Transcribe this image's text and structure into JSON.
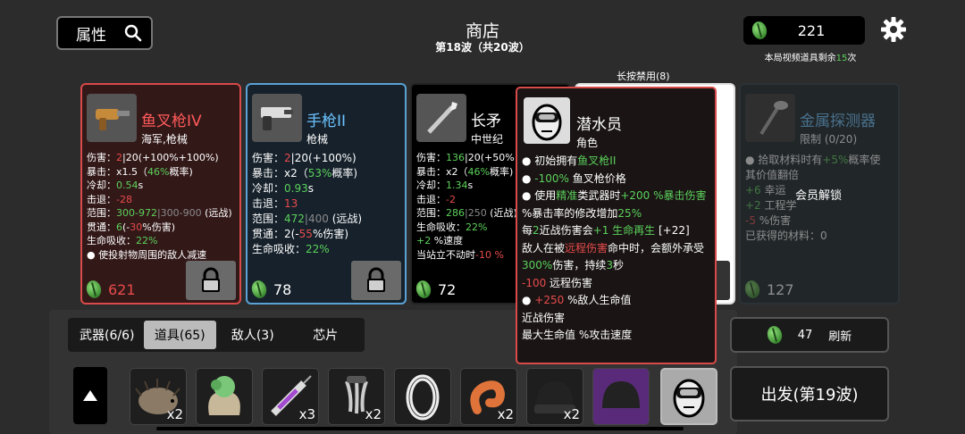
{
  "header": {
    "attr_button": "属性",
    "shop_title": "商店",
    "wave_text": "第18波（共20波）",
    "currency_value": "221",
    "video_prefix": "本局视频道具剩余",
    "video_count": "15",
    "video_suffix": "次",
    "long_press": "长按禁用(8)"
  },
  "cards": [
    {
      "name": "鱼叉枪IV",
      "type": "海军,枪械",
      "price": "621",
      "stats": [
        [
          [
            "伤害：",
            ""
          ],
          [
            "2",
            "red"
          ],
          [
            "|20(+100%",
            ""
          ],
          [
            "+100%)",
            ""
          ]
        ],
        [
          [
            "暴击：x1.5（",
            ""
          ],
          [
            "46%",
            "green"
          ],
          [
            "概率)",
            ""
          ]
        ],
        [
          [
            "冷却：",
            ""
          ],
          [
            "0.54",
            "green"
          ],
          [
            "s",
            ""
          ]
        ],
        [
          [
            "击退：",
            ""
          ],
          [
            "-28",
            "red"
          ]
        ],
        [
          [
            "范围：",
            ""
          ],
          [
            "300-972",
            "green"
          ],
          [
            "|300-900",
            "grey"
          ],
          [
            " (远战)",
            ""
          ]
        ],
        [
          [
            "贯通：",
            ""
          ],
          [
            "6",
            "green"
          ],
          [
            "(-",
            ""
          ],
          [
            "30",
            "red"
          ],
          [
            "%伤害)",
            ""
          ]
        ],
        [
          [
            "生命吸收：",
            ""
          ],
          [
            "22%",
            "green"
          ]
        ],
        [
          [
            "● 使投射物周围的敌人减速",
            ""
          ]
        ]
      ]
    },
    {
      "name": "手枪II",
      "type": "枪械",
      "price": "78",
      "stats": [
        [
          [
            "伤害：",
            ""
          ],
          [
            "2",
            "red"
          ],
          [
            "|20(+100%",
            ""
          ],
          [
            ")",
            ""
          ]
        ],
        [
          [
            "暴击：x2（",
            ""
          ],
          [
            "53%",
            "green"
          ],
          [
            "概率)",
            ""
          ]
        ],
        [
          [
            "冷却：",
            ""
          ],
          [
            "0.93",
            "green"
          ],
          [
            "s",
            ""
          ]
        ],
        [
          [
            "击退：",
            ""
          ],
          [
            "13",
            "red"
          ]
        ],
        [
          [
            "范围：",
            ""
          ],
          [
            "472",
            "green"
          ],
          [
            "|400",
            "grey"
          ],
          [
            " (远战)",
            ""
          ]
        ],
        [
          [
            "贯通：2(-",
            ""
          ],
          [
            "55",
            "red"
          ],
          [
            "%伤害)",
            ""
          ]
        ],
        [
          [
            "生命吸收：",
            ""
          ],
          [
            "22%",
            "green"
          ]
        ]
      ]
    },
    {
      "name": "长矛",
      "type": "中世纪",
      "price": "72",
      "stats": [
        [
          [
            "伤害：",
            ""
          ],
          [
            "136",
            "green"
          ],
          [
            "|20(+50%",
            ""
          ]
        ],
        [
          [
            "暴击：x2（",
            ""
          ],
          [
            "46%",
            "green"
          ],
          [
            "概率)",
            ""
          ]
        ],
        [
          [
            "冷却：",
            ""
          ],
          [
            "1.34",
            "green"
          ],
          [
            "s",
            ""
          ]
        ],
        [
          [
            "击退：",
            ""
          ],
          [
            "-2",
            "red"
          ]
        ],
        [
          [
            "范围：",
            ""
          ],
          [
            "286",
            "green"
          ],
          [
            "|250",
            "grey"
          ],
          [
            " (近战)",
            ""
          ]
        ],
        [
          [
            "生命吸收：",
            ""
          ],
          [
            "22%",
            "green"
          ]
        ],
        [
          [
            "+2",
            "green"
          ],
          [
            " %速度",
            ""
          ]
        ],
        [
          [
            "当站立不动时",
            ""
          ],
          [
            "-10 %",
            "red"
          ]
        ]
      ]
    },
    {
      "name": "",
      "type": "",
      "price": ""
    },
    {
      "name": "金属探测器",
      "type": "限制 (0/20)",
      "price": "127",
      "stats": [
        [
          [
            "● 拾取材料时有",
            ""
          ],
          [
            "+5%",
            "green"
          ],
          [
            "概率使",
            ""
          ]
        ],
        [
          [
            "其价值翻倍",
            ""
          ]
        ],
        [
          [
            "+6",
            "green"
          ],
          [
            " 幸运",
            ""
          ]
        ],
        [
          [
            "+2",
            "green"
          ],
          [
            " 工程学",
            ""
          ]
        ],
        [
          [
            "-5",
            "red"
          ],
          [
            " %伤害",
            ""
          ]
        ],
        [
          [
            "已获得的材料：0",
            ""
          ]
        ]
      ]
    }
  ],
  "member_unlock": "会员解锁",
  "tooltip": {
    "name": "潜水员",
    "type": "角色",
    "lines": [
      [
        [
          "● 初始拥有",
          ""
        ],
        [
          "鱼叉枪II",
          "green"
        ]
      ],
      [
        [
          "● ",
          ""
        ],
        [
          "-100%",
          "green"
        ],
        [
          " 鱼叉枪",
          ""
        ],
        [
          "价格",
          ""
        ]
      ],
      [
        [
          "● 使用",
          ""
        ],
        [
          "精准",
          "green"
        ],
        [
          "类武器时",
          ""
        ],
        [
          "+200 %暴击伤害",
          "green"
        ]
      ],
      [
        [
          "%暴击率",
          ""
        ],
        [
          "的修改增加",
          ""
        ],
        [
          "25%",
          "green"
        ]
      ],
      [
        [
          "每",
          ""
        ],
        [
          "2",
          "green"
        ],
        [
          "近战伤害会",
          ""
        ],
        [
          "+1 生命再生",
          "green"
        ],
        [
          " [+22]",
          ""
        ]
      ],
      [
        [
          "敌人在被",
          ""
        ],
        [
          "远程伤害",
          "red"
        ],
        [
          "命中时，会额外承受",
          ""
        ],
        [
          "300%",
          "green"
        ],
        [
          "伤害，持续",
          ""
        ],
        [
          "3",
          "green"
        ],
        [
          "秒",
          ""
        ]
      ],
      [
        [
          "-100",
          "red"
        ],
        [
          " 远程伤害",
          ""
        ]
      ],
      [
        [
          "● ",
          ""
        ],
        [
          "+250",
          "red"
        ],
        [
          " %敌人生命值",
          ""
        ]
      ],
      [
        [
          "近战伤害",
          ""
        ]
      ],
      [
        [
          "最大生命值    ",
          ""
        ],
        [
          "%攻击速度",
          ""
        ]
      ]
    ]
  },
  "tabs": [
    "武器(6/6)",
    "道具(65)",
    "敌人(3)",
    "芯片"
  ],
  "active_tab": 1,
  "refresh": {
    "cost": "47",
    "label": "刷新"
  },
  "depart": "出发(第19波)",
  "items": [
    {
      "name": "hedgehog",
      "count": "x2"
    },
    {
      "name": "moss-sack",
      "count": ""
    },
    {
      "name": "syringe",
      "count": "x3"
    },
    {
      "name": "claw",
      "count": "x2"
    },
    {
      "name": "ring",
      "count": ""
    },
    {
      "name": "orange-worm",
      "count": "x2"
    },
    {
      "name": "beanie",
      "count": "x2"
    },
    {
      "name": "purple-beanie",
      "count": ""
    },
    {
      "name": "diver-mask",
      "count": ""
    }
  ]
}
